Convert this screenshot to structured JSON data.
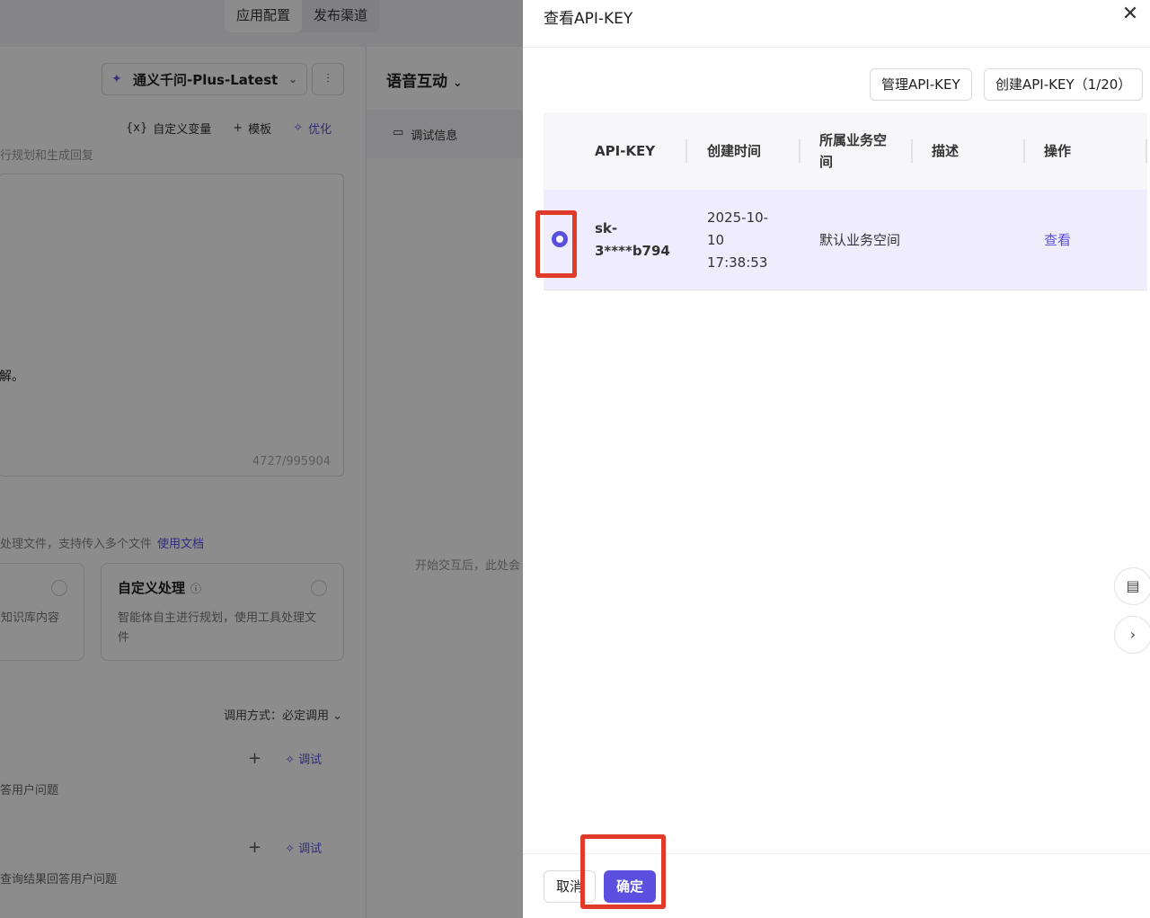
{
  "topnav": {
    "tabs": [
      "应用配置",
      "发布渠道"
    ]
  },
  "left": {
    "model": "通义千问-Plus-Latest",
    "toolbar": {
      "vars": "自定义变量",
      "template": "模板",
      "optimize": "优化",
      "vars_icon": "{x}"
    },
    "prompt_hint": "行规划和生成回复",
    "prompt_text": "解。",
    "char_count": "4727/995904",
    "file_hint": "处理文件，支持传入多个文件",
    "file_doc_link": "使用文档",
    "card1_desc": "知识库内容",
    "card2_title": "自定义处理",
    "card2_desc": "智能体自主进行规划，使用工具处理文件",
    "call_mode": "调用方式：必定调用",
    "debug": "调试",
    "tool1_desc": "答用户问题",
    "tool2_desc": "查询结果回答用户问题"
  },
  "middle": {
    "voice_title": "语音互动",
    "debug_info": "调试信息",
    "start_hint": "开始交互后，此处会"
  },
  "drawer": {
    "title": "查看API-KEY",
    "manage_btn": "管理API-KEY",
    "create_btn": "创建API-KEY（1/20）",
    "columns": [
      "API-KEY",
      "创建时间",
      "所属业务空间",
      "描述",
      "操作"
    ],
    "rows": [
      {
        "key": "sk-3****b794",
        "created": "2025-10-10 17:38:53",
        "space": "默认业务空间",
        "desc": "",
        "action": "查看",
        "selected": true
      }
    ],
    "cancel": "取消",
    "ok": "确定"
  },
  "colors": {
    "accent": "#5b4fe0",
    "highlight": "#e23a2a",
    "row_selected": "#efedfd"
  }
}
